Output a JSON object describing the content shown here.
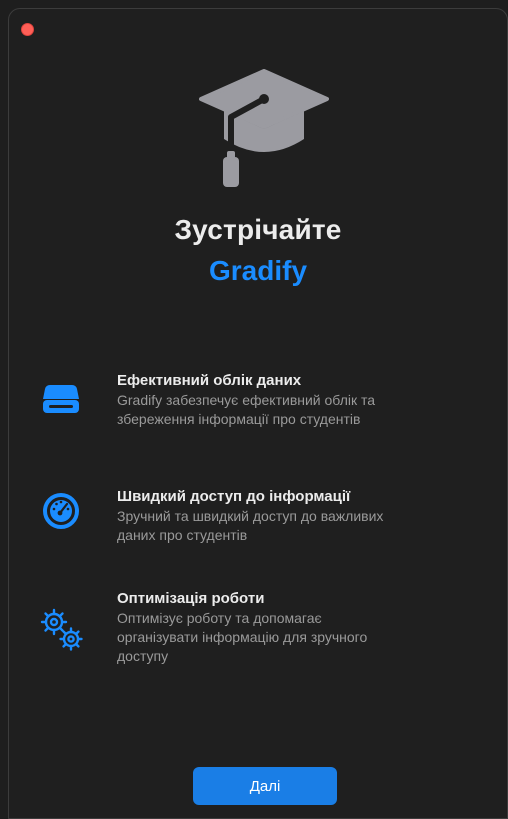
{
  "window": {
    "close_color": "#ff5f57"
  },
  "hero": {
    "icon": "graduation-cap-icon",
    "title": "Зустрічайте",
    "app_name": "Gradify",
    "accent_color": "#1a8cff"
  },
  "features": [
    {
      "icon": "drive-icon",
      "title": "Ефективний облік даних",
      "desc_line1": "Gradify забезпечує ефективний облік та",
      "desc_line2": "збереження інформації про студентів"
    },
    {
      "icon": "gauge-icon",
      "title": "Швидкий доступ до інформації",
      "desc_line1": "Зручний та швидкий доступ до важливих",
      "desc_line2": "даних про студентів"
    },
    {
      "icon": "gears-icon",
      "title": "Оптимізація роботи",
      "desc_line1": "Оптимізує роботу та допомагає",
      "desc_line2": "організувати інформацію для зручного",
      "desc_line3": "доступу"
    }
  ],
  "footer": {
    "next_label": "Далі",
    "button_color": "#1a7ee6"
  }
}
